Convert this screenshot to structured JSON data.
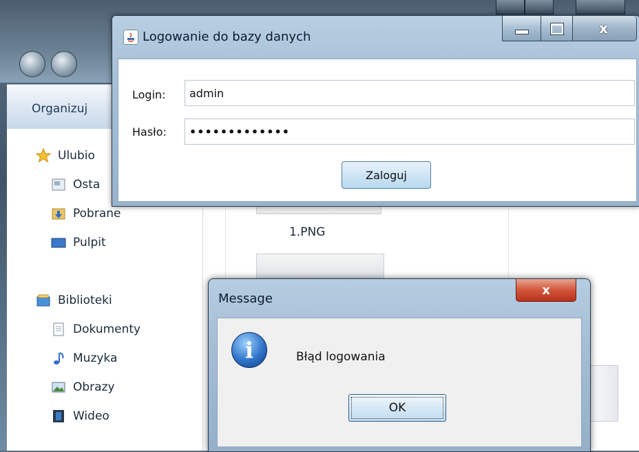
{
  "explorer": {
    "toolbar_organize": "Organizuj",
    "nav": {
      "favorites_label": "Ulubio",
      "recent_label": "Osta",
      "downloads_label": "Pobrane",
      "desktop_label": "Pulpit",
      "libraries_label": "Biblioteki",
      "documents_label": "Dokumenty",
      "music_label": "Muzyka",
      "pictures_label": "Obrazy",
      "videos_label": "Wideo"
    },
    "files": [
      {
        "name": "1.PNG"
      }
    ]
  },
  "login_window": {
    "title": "Logowanie do bazy danych",
    "login_label": "Login:",
    "login_value": "admin",
    "password_label": "Hasło:",
    "password_mask": "•••••••••••••",
    "submit_label": "Zaloguj",
    "icons": {
      "app": "java-icon",
      "minimize": "minimize-icon",
      "maximize": "maximize-icon",
      "close": "close-icon"
    }
  },
  "message_dialog": {
    "title": "Message",
    "text": "Błąd logowania",
    "ok_label": "OK",
    "close_glyph": "x",
    "info_glyph": "i",
    "icons": {
      "info": "info-icon",
      "close": "close-icon"
    },
    "close_color": "#d2563b"
  }
}
